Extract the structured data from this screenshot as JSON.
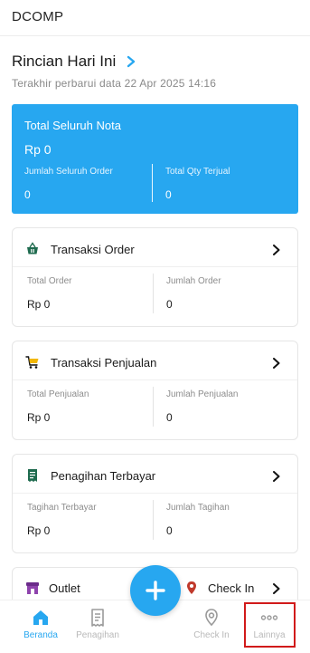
{
  "app": {
    "title": "DCOMP"
  },
  "section": {
    "title": "Rincian Hari Ini",
    "updated": "Terakhir perbarui data 22 Apr 2025 14:16"
  },
  "summary": {
    "label": "Total Seluruh Nota",
    "value": "Rp 0",
    "left_label": "Jumlah Seluruh Order",
    "left_value": "0",
    "right_label": "Total Qty Terjual",
    "right_value": "0"
  },
  "cards": [
    {
      "title": "Transaksi Order",
      "icon": "basket-icon",
      "left_label": "Total Order",
      "left_value": "Rp 0",
      "right_label": "Jumlah Order",
      "right_value": "0"
    },
    {
      "title": "Transaksi Penjualan",
      "icon": "cart-icon",
      "left_label": "Total Penjualan",
      "left_value": "Rp 0",
      "right_label": "Jumlah Penjualan",
      "right_value": "0"
    },
    {
      "title": "Penagihan Terbayar",
      "icon": "receipt-icon",
      "left_label": "Tagihan Terbayar",
      "left_value": "Rp 0",
      "right_label": "Jumlah Tagihan",
      "right_value": "0"
    }
  ],
  "partial_card": {
    "left_label": "Outlet",
    "right_label": "Check In"
  },
  "nav": {
    "items": [
      {
        "label": "Beranda",
        "icon": "home-icon",
        "active": true
      },
      {
        "label": "Penagihan",
        "icon": "receipt-icon",
        "active": false
      },
      {
        "label": "Check In",
        "icon": "location-pin-icon",
        "active": false
      },
      {
        "label": "Lainnya",
        "icon": "more-dots-icon",
        "active": false
      }
    ]
  },
  "colors": {
    "accent": "#27a7f0",
    "highlight": "#d11a1a",
    "icon_dark": "#1f6b4f"
  }
}
